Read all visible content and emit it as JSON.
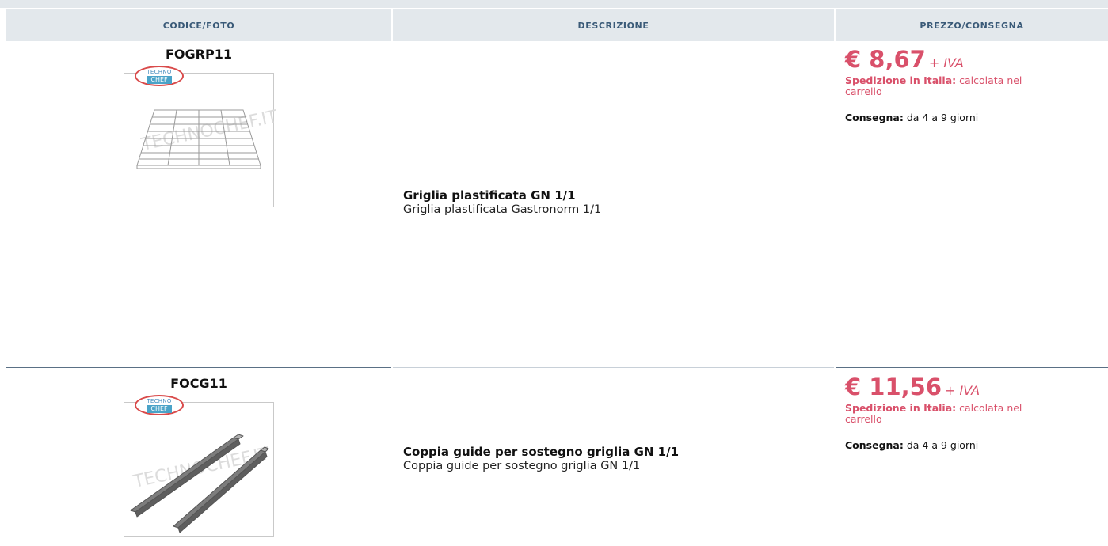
{
  "table": {
    "headers": {
      "code_photo": "CODICE/FOTO",
      "description": "DESCRIZIONE",
      "price_delivery": "PREZZO/CONSEGNA"
    },
    "rows": [
      {
        "code": "FOGRP11",
        "photo": {
          "logo_top": "TECHNO",
          "logo_bottom": "CHEF",
          "watermark": "TECHNOCHEF.IT",
          "icon": "wire-grid-shelf"
        },
        "title": "Griglia plastificata GN 1/1",
        "text": "Griglia plastificata Gastronorm 1/1",
        "price": "€ 8,67",
        "vat": "+ IVA",
        "shipping_label": "Spedizione in Italia:",
        "shipping_value": "calcolata nel carrello",
        "delivery_label": "Consegna:",
        "delivery_value": "da 4 a 9 giorni"
      },
      {
        "code": "FOCG11",
        "photo": {
          "logo_top": "TECHNO",
          "logo_bottom": "CHEF",
          "watermark": "TECHNOCHEF.IT",
          "icon": "pair-of-rails"
        },
        "title": "Coppia guide per sostegno griglia GN 1/1",
        "text": "Coppia guide per sostegno griglia GN 1/1",
        "price": "€ 11,56",
        "vat": "+ IVA",
        "shipping_label": "Spedizione in Italia:",
        "shipping_value": "calcolata nel carrello",
        "delivery_label": "Consegna:",
        "delivery_value": "da 4 a 9 giorni"
      }
    ]
  },
  "colors": {
    "header_bg": "#e3e8ec",
    "header_text": "#3a5a78",
    "price": "#d9506a",
    "row_separator": "#5a7085"
  }
}
